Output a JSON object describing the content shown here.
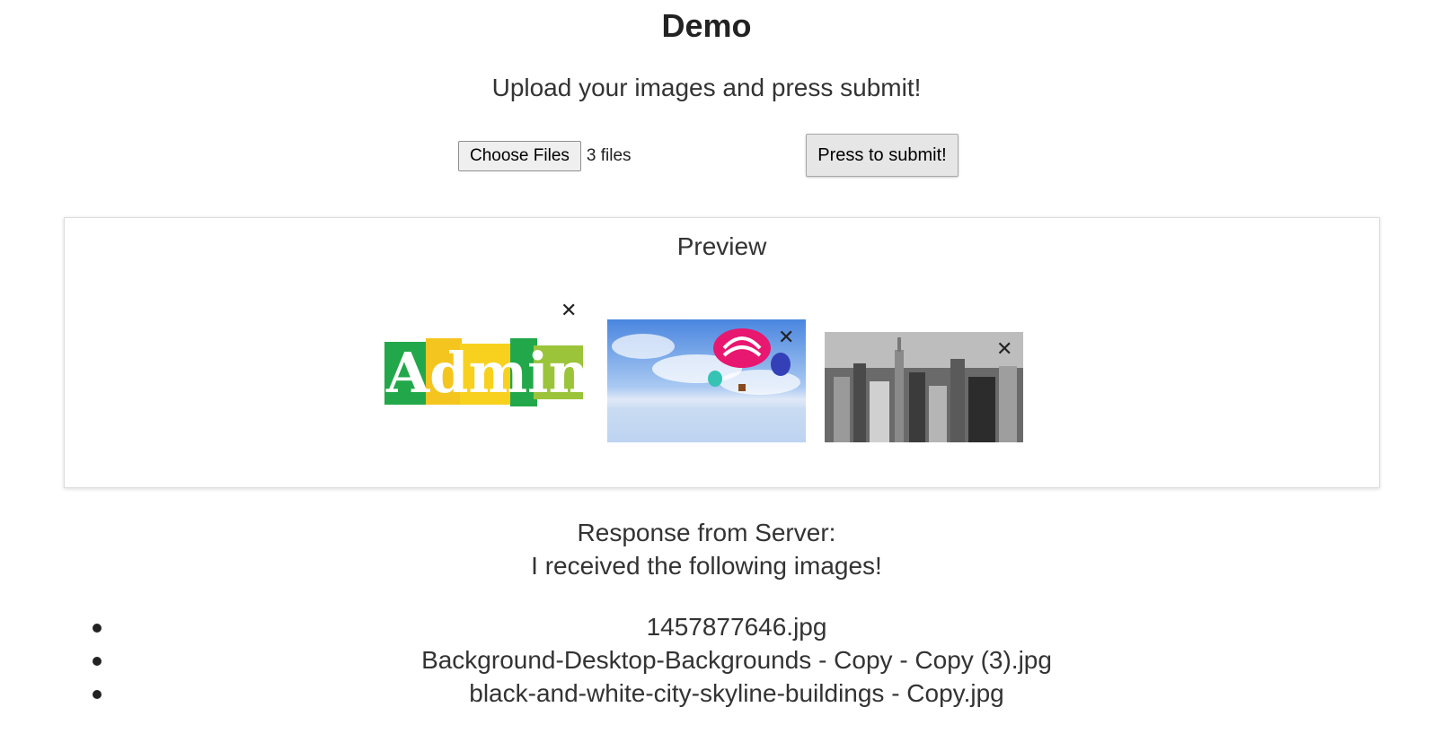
{
  "header": {
    "title": "Demo",
    "subtitle": "Upload your images and press submit!"
  },
  "upload": {
    "choose_label": "Choose Files",
    "file_count": "3 files",
    "submit_label": "Press to submit!"
  },
  "preview": {
    "heading": "Preview",
    "images": [
      {
        "name": "admin-logo-image",
        "alt_text": "Admin",
        "close": "✕"
      },
      {
        "name": "balloons-image",
        "close": "✕"
      },
      {
        "name": "city-skyline-image",
        "close": "✕"
      }
    ]
  },
  "response": {
    "line1": "Response from Server:",
    "line2": "I received the following images!",
    "files": [
      "1457877646.jpg",
      "Background-Desktop-Backgrounds - Copy - Copy (3).jpg",
      "black-and-white-city-skyline-buildings - Copy.jpg"
    ]
  }
}
